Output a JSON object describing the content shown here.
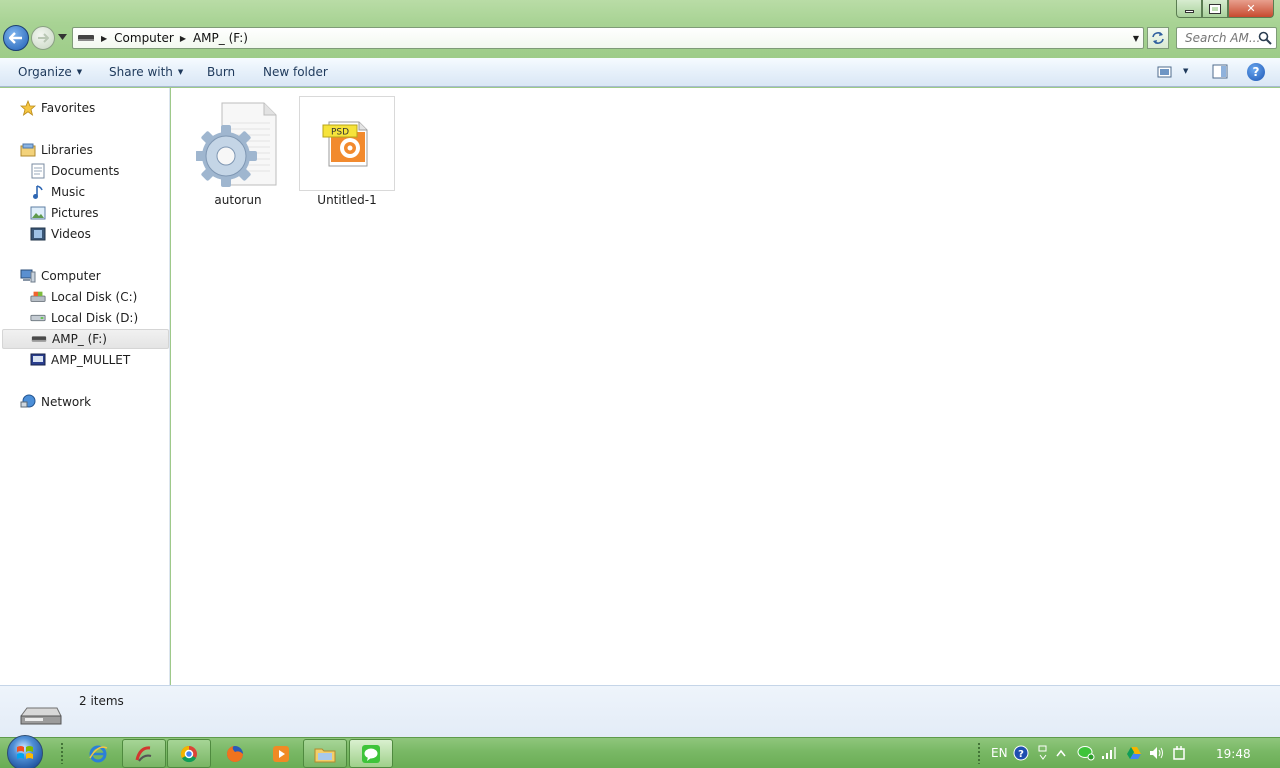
{
  "address": {
    "crumbs": [
      "Computer",
      "AMP_ (F:)"
    ]
  },
  "search": {
    "placeholder": "Search AM..."
  },
  "toolbar": {
    "organize": "Organize",
    "share_with": "Share with",
    "burn": "Burn",
    "new_folder": "New folder",
    "help": "?"
  },
  "nav": {
    "favorites": "Favorites",
    "libraries": "Libraries",
    "documents": "Documents",
    "music": "Music",
    "pictures": "Pictures",
    "videos": "Videos",
    "computer": "Computer",
    "disk_c": "Local Disk (C:)",
    "disk_d": "Local Disk (D:)",
    "drive_f": "AMP_ (F:)",
    "amp_mullet": "AMP_MULLET",
    "network": "Network"
  },
  "files": [
    {
      "name": "autorun",
      "icon": "settings-file-icon"
    },
    {
      "name": "Untitled-1",
      "icon": "psd-file-icon",
      "badge": "PSD"
    }
  ],
  "status": {
    "item_count": "2 items"
  },
  "tray": {
    "language": "EN",
    "time": "19:48"
  },
  "colors": {
    "window_frame": "#a8d394",
    "command_bar": "#e6f0fa",
    "taskbar": "#79b865",
    "selection": "#e4e4e4"
  }
}
